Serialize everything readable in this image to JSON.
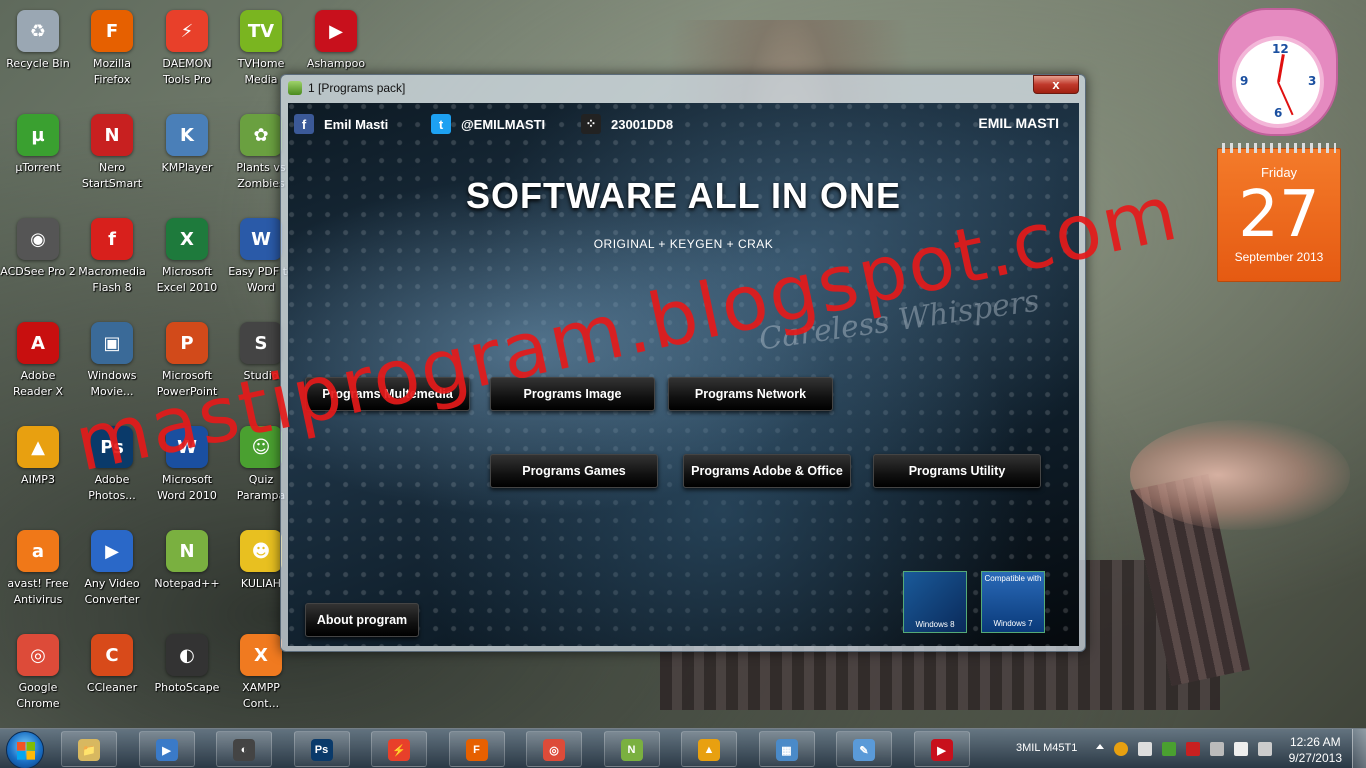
{
  "desktop": {
    "icons": [
      {
        "label": "Recycle Bin",
        "glyph": "♻",
        "color": "#9aa7b3"
      },
      {
        "label": "Mozilla Firefox",
        "glyph": "F",
        "color": "#e66000"
      },
      {
        "label": "DAEMON Tools Pro",
        "glyph": "⚡",
        "color": "#e8402a"
      },
      {
        "label": "TVHome Media",
        "glyph": "TV",
        "color": "#7ab520"
      },
      {
        "label": "Ashampoo",
        "glyph": "▶",
        "color": "#c8101c"
      },
      {
        "label": "µTorrent",
        "glyph": "µ",
        "color": "#3aa030"
      },
      {
        "label": "Nero StartSmart",
        "glyph": "N",
        "color": "#c82020"
      },
      {
        "label": "KMPlayer",
        "glyph": "K",
        "color": "#4a7fb8"
      },
      {
        "label": "Plants vs Zombies",
        "glyph": "✿",
        "color": "#6aa040"
      },
      {
        "label": "ACDSee Pro 2",
        "glyph": "◉",
        "color": "#555"
      },
      {
        "label": "Macromedia Flash 8",
        "glyph": "f",
        "color": "#d8201c"
      },
      {
        "label": "Microsoft Excel 2010",
        "glyph": "X",
        "color": "#1e7a3c"
      },
      {
        "label": "Easy PDF to Word",
        "glyph": "W",
        "color": "#2a5aa8"
      },
      {
        "label": "Adobe Reader X",
        "glyph": "A",
        "color": "#c80f0f"
      },
      {
        "label": "Windows Movie...",
        "glyph": "▣",
        "color": "#3a6a98"
      },
      {
        "label": "Microsoft PowerPoint",
        "glyph": "P",
        "color": "#d24a1a"
      },
      {
        "label": "Studio",
        "glyph": "S",
        "color": "#444"
      },
      {
        "label": "AIMP3",
        "glyph": "▲",
        "color": "#e8a010"
      },
      {
        "label": "Adobe Photos...",
        "glyph": "Ps",
        "color": "#0a3a6a"
      },
      {
        "label": "Microsoft Word 2010",
        "glyph": "W",
        "color": "#1a4fa0"
      },
      {
        "label": "Quiz Parampa",
        "glyph": "☺",
        "color": "#4aa030"
      },
      {
        "label": "avast! Free Antivirus",
        "glyph": "a",
        "color": "#f07818"
      },
      {
        "label": "Any Video Converter",
        "glyph": "▶",
        "color": "#2a68c8"
      },
      {
        "label": "Notepad++",
        "glyph": "N",
        "color": "#7ab040"
      },
      {
        "label": "KULIAH",
        "glyph": "☻",
        "color": "#e8c020"
      },
      {
        "label": "Google Chrome",
        "glyph": "◎",
        "color": "#dd4b39"
      },
      {
        "label": "CCleaner",
        "glyph": "C",
        "color": "#d84a1a"
      },
      {
        "label": "PhotoScape",
        "glyph": "◐",
        "color": "#333"
      },
      {
        "label": "XAMPP Cont...",
        "glyph": "X",
        "color": "#f07a20"
      }
    ]
  },
  "watermark": "mastiprogram.blogspot.com",
  "gadgets": {
    "clock": {
      "numbers": [
        "12",
        "3",
        "6",
        "9"
      ]
    },
    "calendar": {
      "day": "Friday",
      "date": "27",
      "month": "September 2013"
    }
  },
  "window": {
    "title": "1 [Programs pack]",
    "close_label": "x",
    "facebook": {
      "icon": "facebook-icon",
      "text": "Emil Masti"
    },
    "twitter": {
      "icon": "twitter-icon",
      "text": "@EMILMASTI"
    },
    "blackberry": {
      "icon": "blackberry-icon",
      "text": "23001DD8"
    },
    "brand": "EMIL MASTI",
    "headline": "SOFTWARE ALL IN ONE",
    "subline": "ORIGINAL + KEYGEN + CRAK",
    "signature": "Careless Whispers",
    "buttons": {
      "multimedia": "Programs Multemedia",
      "image": "Programs Image",
      "network": "Programs Network",
      "games": "Programs Games",
      "adobe_office": "Programs Adobe & Office",
      "utility": "Programs Utility",
      "about": "About program"
    },
    "badges": {
      "win8": "Windows 8",
      "win7_top": "Compatible with",
      "win7": "Windows 7"
    }
  },
  "taskbar": {
    "apps": [
      {
        "name": "explorer",
        "glyph": "📁",
        "color": "#d8b860"
      },
      {
        "name": "media-player",
        "glyph": "▶",
        "color": "#3a7ac8"
      },
      {
        "name": "photoscape",
        "glyph": "◐",
        "color": "#444"
      },
      {
        "name": "photoshop",
        "glyph": "Ps",
        "color": "#0a3a6a"
      },
      {
        "name": "daemon-tools",
        "glyph": "⚡",
        "color": "#e8402a"
      },
      {
        "name": "firefox",
        "glyph": "F",
        "color": "#e66000"
      },
      {
        "name": "chrome",
        "glyph": "◎",
        "color": "#dd4b39"
      },
      {
        "name": "notepad-plus-plus",
        "glyph": "N",
        "color": "#7ab040"
      },
      {
        "name": "aimp",
        "glyph": "▲",
        "color": "#e8a010"
      },
      {
        "name": "control-panel",
        "glyph": "▦",
        "color": "#4a8ac8"
      },
      {
        "name": "paint",
        "glyph": "✎",
        "color": "#5a9ad8"
      },
      {
        "name": "ashampoo",
        "glyph": "▶",
        "color": "#c8101c"
      }
    ],
    "tray_user": "3MIL M45T1",
    "time": "12:26 AM",
    "date": "9/27/2013"
  },
  "colors": {
    "watermark": "#e51a1a",
    "calendar": "#e55a12",
    "accent": "#1a6fc4"
  }
}
